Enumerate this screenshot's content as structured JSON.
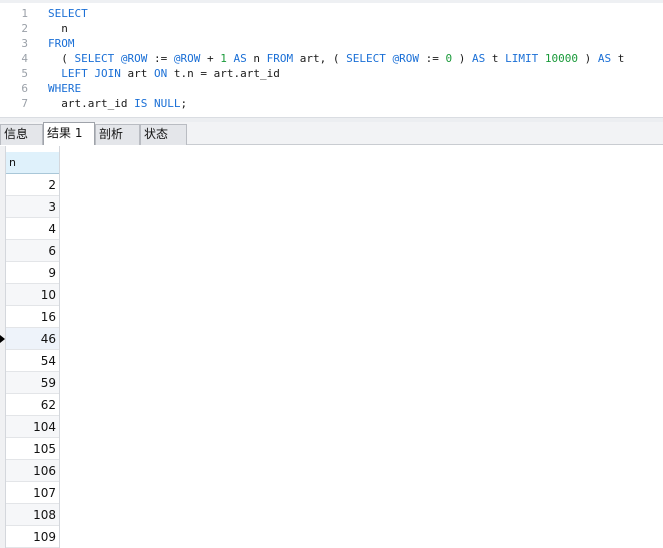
{
  "editor": {
    "lines": [
      {
        "no": "1",
        "tokens": [
          {
            "t": "SELECT",
            "c": "kw"
          }
        ]
      },
      {
        "no": "2",
        "tokens": [
          {
            "t": "  n",
            "c": ""
          }
        ]
      },
      {
        "no": "3",
        "tokens": [
          {
            "t": "FROM",
            "c": "kw"
          }
        ]
      },
      {
        "no": "4",
        "tokens": [
          {
            "t": "  ( ",
            "c": ""
          },
          {
            "t": "SELECT",
            "c": "kw"
          },
          {
            "t": " ",
            "c": ""
          },
          {
            "t": "@ROW",
            "c": "var"
          },
          {
            "t": " := ",
            "c": ""
          },
          {
            "t": "@ROW",
            "c": "var"
          },
          {
            "t": " + ",
            "c": ""
          },
          {
            "t": "1",
            "c": "num"
          },
          {
            "t": " ",
            "c": ""
          },
          {
            "t": "AS",
            "c": "kw"
          },
          {
            "t": " n ",
            "c": ""
          },
          {
            "t": "FROM",
            "c": "kw"
          },
          {
            "t": " art, ( ",
            "c": ""
          },
          {
            "t": "SELECT",
            "c": "kw"
          },
          {
            "t": " ",
            "c": ""
          },
          {
            "t": "@ROW",
            "c": "var"
          },
          {
            "t": " := ",
            "c": ""
          },
          {
            "t": "0",
            "c": "num"
          },
          {
            "t": " ) ",
            "c": ""
          },
          {
            "t": "AS",
            "c": "kw"
          },
          {
            "t": " t ",
            "c": ""
          },
          {
            "t": "LIMIT",
            "c": "kw"
          },
          {
            "t": " ",
            "c": ""
          },
          {
            "t": "10000",
            "c": "num"
          },
          {
            "t": " ) ",
            "c": ""
          },
          {
            "t": "AS",
            "c": "kw"
          },
          {
            "t": " t",
            "c": ""
          }
        ]
      },
      {
        "no": "5",
        "tokens": [
          {
            "t": "  ",
            "c": ""
          },
          {
            "t": "LEFT JOIN",
            "c": "kw"
          },
          {
            "t": " art ",
            "c": ""
          },
          {
            "t": "ON",
            "c": "kw"
          },
          {
            "t": " t.n = art.art_id",
            "c": ""
          }
        ]
      },
      {
        "no": "6",
        "tokens": [
          {
            "t": "WHERE",
            "c": "kw"
          }
        ]
      },
      {
        "no": "7",
        "tokens": [
          {
            "t": "  art.art_id ",
            "c": ""
          },
          {
            "t": "IS",
            "c": "kw"
          },
          {
            "t": " ",
            "c": ""
          },
          {
            "t": "NULL",
            "c": "kw"
          },
          {
            "t": ";",
            "c": ""
          }
        ]
      }
    ]
  },
  "tabs": [
    {
      "label": "信息",
      "active": false
    },
    {
      "label": "结果 1",
      "active": true
    },
    {
      "label": "剖析",
      "active": false
    },
    {
      "label": "状态",
      "active": false
    }
  ],
  "grid": {
    "column": "n",
    "rows": [
      "2",
      "3",
      "4",
      "6",
      "9",
      "10",
      "16",
      "46",
      "54",
      "59",
      "62",
      "104",
      "105",
      "106",
      "107",
      "108",
      "109"
    ],
    "current_row": 7
  }
}
